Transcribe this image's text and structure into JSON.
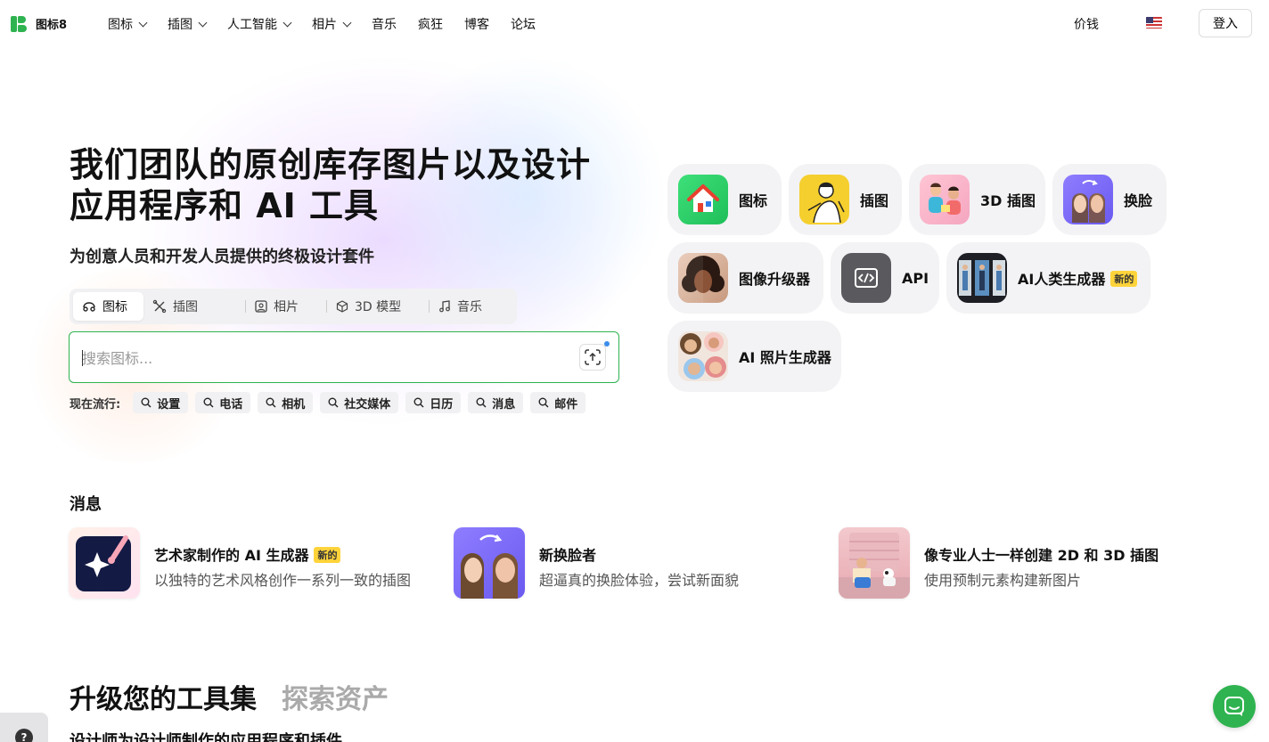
{
  "brand": {
    "name": "图标8",
    "color": "#2fb350"
  },
  "nav": {
    "items": [
      {
        "label": "图标",
        "dropdown": true
      },
      {
        "label": "插图",
        "dropdown": true
      },
      {
        "label": "人工智能",
        "dropdown": true
      },
      {
        "label": "相片",
        "dropdown": true
      },
      {
        "label": "音乐",
        "dropdown": false
      },
      {
        "label": "疯狂",
        "dropdown": false
      },
      {
        "label": "博客",
        "dropdown": false
      },
      {
        "label": "论坛",
        "dropdown": false
      }
    ],
    "price": "价钱",
    "language_icon": "us-flag-icon",
    "login": "登入"
  },
  "hero": {
    "title": "我们团队的原创库存图片以及设计应用程序和 AI 工具",
    "subtitle": "为创意人员和开发人员提供的终极设计套件",
    "tabs": [
      {
        "label": "图标",
        "icon": "icons-icon",
        "active": true
      },
      {
        "label": "插图",
        "icon": "illustration-icon",
        "active": false
      },
      {
        "label": "相片",
        "icon": "photo-icon",
        "active": false
      },
      {
        "label": "3D 模型",
        "icon": "cube-icon",
        "active": false
      },
      {
        "label": "音乐",
        "icon": "music-note-icon",
        "active": false
      }
    ],
    "search": {
      "placeholder": "搜索图标...",
      "value": ""
    },
    "trending_label": "现在流行:",
    "trending": [
      "设置",
      "电话",
      "相机",
      "社交媒体",
      "日历",
      "消息",
      "邮件"
    ]
  },
  "products": [
    {
      "label": "图标"
    },
    {
      "label": "插图"
    },
    {
      "label": "3D 插图"
    },
    {
      "label": "换脸"
    },
    {
      "label": "图像升级器"
    },
    {
      "label": "API"
    },
    {
      "label": "AI人类生成器",
      "badge": "新的"
    },
    {
      "label": "AI 照片生成器"
    }
  ],
  "news": {
    "title": "消息",
    "items": [
      {
        "title": "艺术家制作的 AI 生成器",
        "badge": "新的",
        "desc": "以独特的艺术风格创作一系列一致的插图"
      },
      {
        "title": "新换脸者",
        "desc": "超逼真的换脸体验，尝试新面貌"
      },
      {
        "title": "像专业人士一样创建 2D 和 3D 插图",
        "desc": "使用预制元素构建新图片"
      }
    ]
  },
  "tools": {
    "title": "升级您的工具集",
    "alt": "探索资产",
    "subtitle": "设计师为设计师制作的应用程序和插件"
  },
  "help": {
    "label": "?"
  }
}
